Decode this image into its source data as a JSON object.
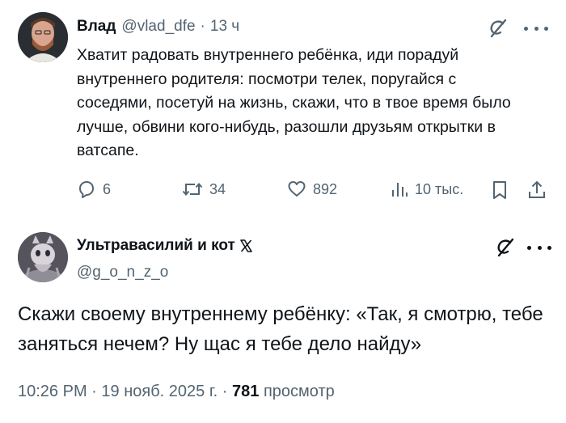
{
  "tweet1": {
    "author_name": "Влад",
    "handle": "@vlad_dfe",
    "separator": "·",
    "time": "13 ч",
    "text": "Хватит радовать внутреннего ребёнка, иди порадуй внутреннего родителя: посмотри телек, поругайся с соседями, посетуй на жизнь, скажи, что в твое время было лучше, обвини кого-нибудь, разошли друзьям открытки в ватсапе.",
    "stats": {
      "replies": "6",
      "reposts": "34",
      "likes": "892",
      "views": "10 тыс."
    },
    "icons": [
      "grok-icon",
      "more-icon",
      "reply-icon",
      "repost-icon",
      "like-icon",
      "views-icon",
      "bookmark-icon",
      "share-icon"
    ]
  },
  "tweet2": {
    "author_name": "Ультравасилий и кот",
    "handle": "@g_o_n_z_o",
    "text": "Скажи своему внутреннему ребёнку: «Так, я смотрю, тебе заняться нечем? Ну щас я тебе дело найду»",
    "time": "10:26 PM",
    "separator": "·",
    "date": "19 нояб. 2025 г.",
    "view_count": "781",
    "view_label": "просмотр",
    "icons": [
      "x-logo-icon",
      "grok-icon",
      "more-icon"
    ]
  },
  "colors": {
    "text": "#0f1419",
    "secondary": "#536471"
  }
}
